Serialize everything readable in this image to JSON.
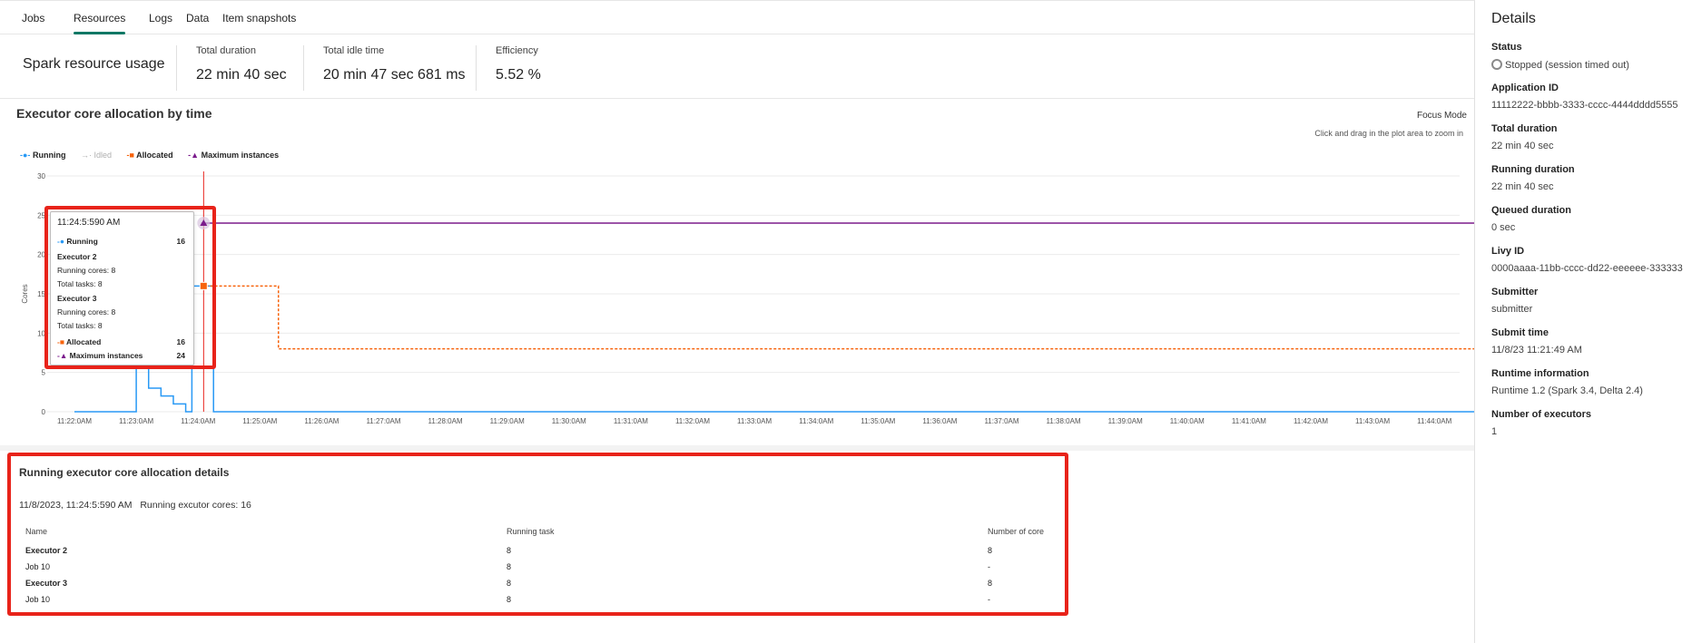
{
  "tabs": [
    "Jobs",
    "Resources",
    "Logs",
    "Data",
    "Item snapshots"
  ],
  "summary": {
    "title": "Spark resource usage",
    "metrics": [
      {
        "label": "Total duration",
        "value": "22 min 40 sec"
      },
      {
        "label": "Total idle time",
        "value": "20 min 47 sec 681 ms"
      },
      {
        "label": "Efficiency",
        "value": "5.52 %"
      }
    ]
  },
  "chart": {
    "title": "Executor core allocation by time",
    "focus_mode": "Focus Mode",
    "hint": "Click and drag in the plot area to zoom in",
    "legend": [
      "Running",
      "Idled",
      "Allocated",
      "Maximum instances"
    ],
    "ylabel": "Cores"
  },
  "chart_data": {
    "type": "line",
    "title": "Executor core allocation by time",
    "ylabel": "Cores",
    "xlabel": "",
    "ylim": [
      0,
      30
    ],
    "yticks": [
      "0",
      "5",
      "10",
      "15",
      "20",
      "25",
      "30"
    ],
    "x": [
      "11:22:0AM",
      "11:23:0AM",
      "11:24:0AM",
      "11:25:0AM",
      "11:26:0AM",
      "11:27:0AM",
      "11:28:0AM",
      "11:29:0AM",
      "11:30:0AM",
      "11:31:0AM",
      "11:32:0AM",
      "11:33:0AM",
      "11:34:0AM",
      "11:35:0AM",
      "11:36:0AM",
      "11:37:0AM",
      "11:38:0AM",
      "11:39:0AM",
      "11:40:0AM",
      "11:41:0AM",
      "11:42:0AM",
      "11:43:0AM",
      "11:44:0AM"
    ],
    "series": [
      {
        "name": "Running",
        "color": "#2899f5",
        "points": [
          [
            0,
            0
          ],
          [
            1,
            0
          ],
          [
            1,
            16
          ],
          [
            1.2,
            16
          ],
          [
            1.2,
            3
          ],
          [
            1.4,
            3
          ],
          [
            1.4,
            2
          ],
          [
            1.6,
            2
          ],
          [
            1.6,
            1
          ],
          [
            1.8,
            1
          ],
          [
            1.8,
            0
          ],
          [
            1.9,
            0
          ],
          [
            1.9,
            16
          ],
          [
            2.25,
            16
          ],
          [
            2.25,
            0
          ],
          [
            22.8,
            0
          ]
        ]
      },
      {
        "name": "Allocated",
        "color": "#f7630c",
        "points": [
          [
            2.05,
            16
          ],
          [
            3.3,
            16
          ],
          [
            3.3,
            8
          ],
          [
            22.8,
            8
          ]
        ]
      },
      {
        "name": "Maximum instances",
        "color": "#7b1b8c",
        "points": [
          [
            2.05,
            24
          ],
          [
            22.8,
            24
          ]
        ]
      }
    ],
    "cursor_x": 2.09
  },
  "tooltip": {
    "time": "11:24:5:590 AM",
    "running_label": "Running",
    "running_value": "16",
    "executor2": "Executor 2",
    "e2_cores": "Running cores: 8",
    "e2_tasks": "Total tasks: 8",
    "executor3": "Executor 3",
    "e3_cores": "Running cores: 8",
    "e3_tasks": "Total tasks: 8",
    "allocated_label": "Allocated",
    "allocated_value": "16",
    "max_label": "Maximum instances",
    "max_value": "24"
  },
  "details_panel": {
    "title": "Running executor core allocation details",
    "subtitle_date": "11/8/2023, 11:24:5:590 AM",
    "subtitle_cores": "Running excutor cores: 16",
    "columns": [
      "Name",
      "Running task",
      "Number of core"
    ],
    "rows": [
      {
        "name": "Executor 2",
        "task": "8",
        "core": "8",
        "bold": true
      },
      {
        "name": "Job 10",
        "task": "8",
        "core": "-",
        "bold": false
      },
      {
        "name": "Executor 3",
        "task": "8",
        "core": "8",
        "bold": true
      },
      {
        "name": "Job 10",
        "task": "8",
        "core": "-",
        "bold": false
      }
    ]
  },
  "details": {
    "title": "Details",
    "items": [
      {
        "k": "Status",
        "v": "Stopped (session timed out)"
      },
      {
        "k": "Application ID",
        "v": "11112222-bbbb-3333-cccc-4444dddd5555"
      },
      {
        "k": "Total duration",
        "v": "22 min 40 sec"
      },
      {
        "k": "Running duration",
        "v": "22 min 40 sec"
      },
      {
        "k": "Queued duration",
        "v": "0 sec"
      },
      {
        "k": "Livy ID",
        "v": "0000aaaa-11bb-cccc-dd22-eeeeee-333333"
      },
      {
        "k": "Submitter",
        "v": "submitter"
      },
      {
        "k": "Submit time",
        "v": "11/8/23 11:21:49 AM"
      },
      {
        "k": "Runtime information",
        "v": "Runtime 1.2 (Spark 3.4, Delta 2.4)"
      },
      {
        "k": "Number of executors",
        "v": "1"
      }
    ]
  }
}
